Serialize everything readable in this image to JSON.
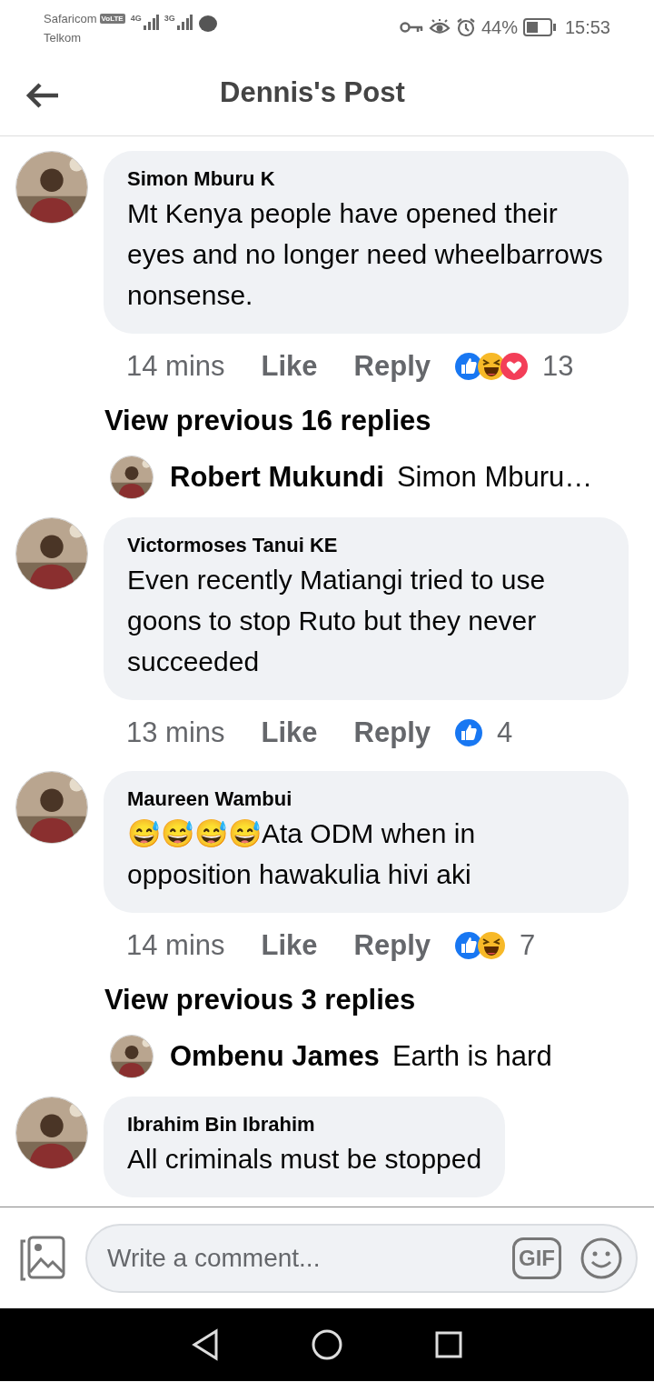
{
  "status_bar": {
    "carrier_1": "Safaricom",
    "volte": "VoLTE",
    "network_1": "4G",
    "carrier_2": "Telkom",
    "network_2": "3G",
    "battery": "44%",
    "time": "15:53"
  },
  "header": {
    "title": "Dennis's Post"
  },
  "feed": [
    {
      "kind": "comment",
      "name": "Simon Mburu K",
      "text": "Mt Kenya people have opened their eyes and no longer need wheelbarrows nonsense.",
      "time": "14 mins",
      "like": "Like",
      "reply": "Reply",
      "reactions": [
        {
          "kind": "like"
        },
        {
          "kind": "haha"
        },
        {
          "kind": "love"
        }
      ],
      "count": "13"
    },
    {
      "kind": "more",
      "label": "View previous 16 replies"
    },
    {
      "kind": "reply",
      "name": "Robert Mukundi",
      "text": "Simon Mburu…"
    },
    {
      "kind": "comment",
      "name": "Victormoses Tanui KE",
      "text": "Even recently Matiangi tried to use goons to stop Ruto but they never succeeded",
      "time": "13 mins",
      "like": "Like",
      "reply": "Reply",
      "reactions": [
        {
          "kind": "like"
        }
      ],
      "count": "4"
    },
    {
      "kind": "comment",
      "name": "Maureen Wambui",
      "text": "😅😅😅😅Ata ODM when in opposition hawakulia hivi aki",
      "time": "14 mins",
      "like": "Like",
      "reply": "Reply",
      "reactions": [
        {
          "kind": "like"
        },
        {
          "kind": "haha"
        }
      ],
      "count": "7"
    },
    {
      "kind": "more",
      "label": "View previous 3 replies"
    },
    {
      "kind": "reply",
      "name": "Ombenu James",
      "text": "Earth is hard"
    },
    {
      "kind": "comment",
      "name": "Ibrahim Bin Ibrahim",
      "text": "All criminals must be stopped"
    }
  ],
  "composer": {
    "placeholder": "Write a comment...",
    "gif": "GIF"
  }
}
